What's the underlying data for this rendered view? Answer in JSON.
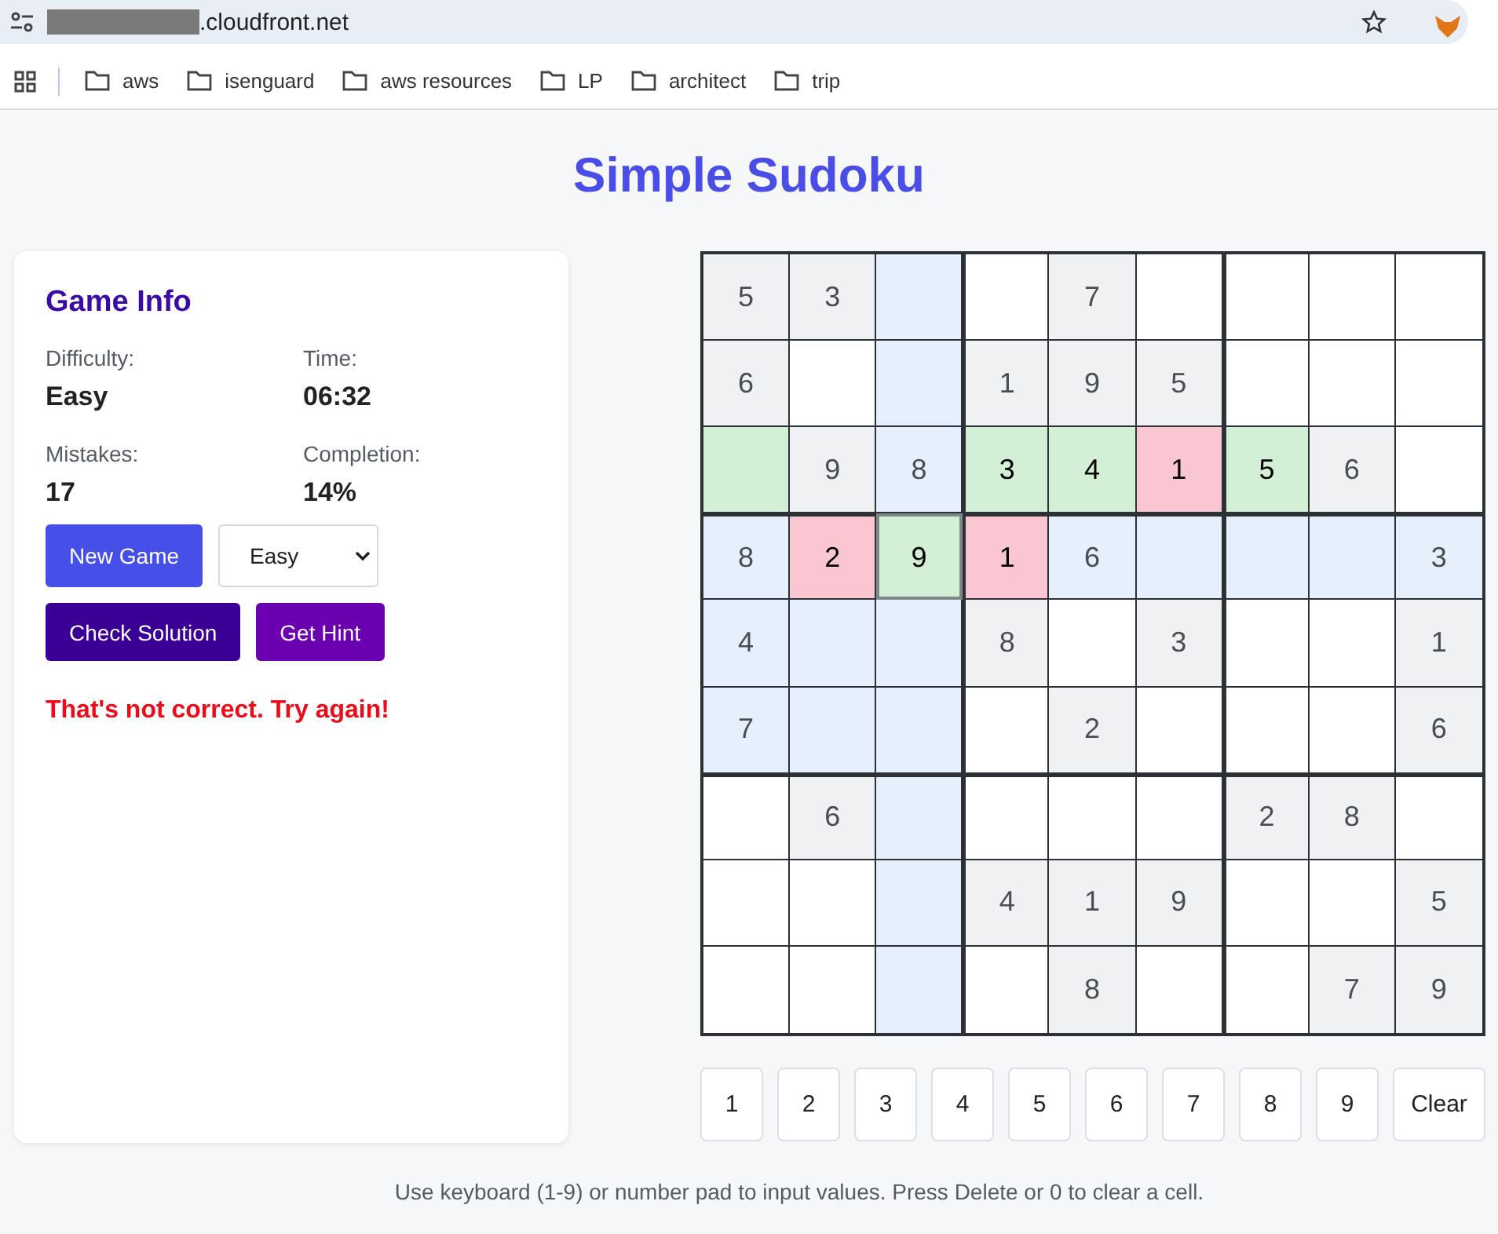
{
  "browser": {
    "url": ".cloudfront.net",
    "bookmarks": [
      "aws",
      "isenguard",
      "aws resources",
      "LP",
      "architect",
      "trip"
    ]
  },
  "title": "Simple Sudoku",
  "info": {
    "heading": "Game Info",
    "stats": [
      {
        "label": "Difficulty:",
        "value": "Easy"
      },
      {
        "label": "Time:",
        "value": "06:32"
      },
      {
        "label": "Mistakes:",
        "value": "17"
      },
      {
        "label": "Completion:",
        "value": "14%"
      }
    ],
    "new_game": "New Game",
    "difficulty_select": "Easy",
    "check": "Check Solution",
    "hint": "Get Hint",
    "message": "That's not correct. Try again!"
  },
  "grid": [
    [
      {
        "kind": "given",
        "value": "5",
        "given": true,
        "selected": false
      },
      {
        "kind": "given",
        "value": "3",
        "given": true,
        "selected": false
      },
      {
        "kind": "related",
        "selected": false
      },
      {
        "kind": "plain",
        "selected": false
      },
      {
        "kind": "given",
        "value": "7",
        "given": true,
        "selected": false
      },
      {
        "kind": "plain",
        "selected": false
      },
      {
        "kind": "plain",
        "selected": false
      },
      {
        "kind": "plain",
        "selected": false
      },
      {
        "kind": "plain",
        "selected": false
      }
    ],
    [
      {
        "kind": "given",
        "value": "6",
        "given": true,
        "selected": false
      },
      {
        "kind": "plain",
        "selected": false
      },
      {
        "kind": "related",
        "selected": false
      },
      {
        "kind": "given",
        "value": "1",
        "given": true,
        "selected": false
      },
      {
        "kind": "given",
        "value": "9",
        "given": true,
        "selected": false
      },
      {
        "kind": "given",
        "value": "5",
        "given": true,
        "selected": false
      },
      {
        "kind": "plain",
        "selected": false
      },
      {
        "kind": "plain",
        "selected": false
      },
      {
        "kind": "plain",
        "selected": false
      }
    ],
    [
      {
        "kind": "correct",
        "selected": false
      },
      {
        "kind": "given",
        "value": "9",
        "given": true,
        "selected": false
      },
      {
        "kind": "related",
        "value": "8",
        "given": true,
        "selected": false
      },
      {
        "kind": "correct",
        "value": "3",
        "given": false,
        "selected": false
      },
      {
        "kind": "correct",
        "value": "4",
        "given": false,
        "selected": false
      },
      {
        "kind": "wrong",
        "value": "1",
        "given": false,
        "selected": false
      },
      {
        "kind": "correct",
        "value": "5",
        "given": false,
        "selected": false
      },
      {
        "kind": "given",
        "value": "6",
        "given": true,
        "selected": false
      },
      {
        "kind": "plain",
        "selected": false
      }
    ],
    [
      {
        "kind": "related",
        "value": "8",
        "given": true,
        "selected": false
      },
      {
        "kind": "wrong",
        "value": "2",
        "given": false,
        "selected": false
      },
      {
        "kind": "correct",
        "value": "9",
        "given": false,
        "selected": true
      },
      {
        "kind": "wrong",
        "value": "1",
        "given": false,
        "selected": false
      },
      {
        "kind": "related",
        "value": "6",
        "given": true,
        "selected": false
      },
      {
        "kind": "related",
        "selected": false
      },
      {
        "kind": "related",
        "selected": false
      },
      {
        "kind": "related",
        "selected": false
      },
      {
        "kind": "related",
        "value": "3",
        "given": true,
        "selected": false
      }
    ],
    [
      {
        "kind": "related",
        "value": "4",
        "given": true,
        "selected": false
      },
      {
        "kind": "related",
        "selected": false
      },
      {
        "kind": "related",
        "selected": false
      },
      {
        "kind": "given",
        "value": "8",
        "given": true,
        "selected": false
      },
      {
        "kind": "plain",
        "selected": false
      },
      {
        "kind": "given",
        "value": "3",
        "given": true,
        "selected": false
      },
      {
        "kind": "plain",
        "selected": false
      },
      {
        "kind": "plain",
        "selected": false
      },
      {
        "kind": "given",
        "value": "1",
        "given": true,
        "selected": false
      }
    ],
    [
      {
        "kind": "related",
        "value": "7",
        "given": true,
        "selected": false
      },
      {
        "kind": "related",
        "selected": false
      },
      {
        "kind": "related",
        "selected": false
      },
      {
        "kind": "plain",
        "selected": false
      },
      {
        "kind": "given",
        "value": "2",
        "given": true,
        "selected": false
      },
      {
        "kind": "plain",
        "selected": false
      },
      {
        "kind": "plain",
        "selected": false
      },
      {
        "kind": "plain",
        "selected": false
      },
      {
        "kind": "given",
        "value": "6",
        "given": true,
        "selected": false
      }
    ],
    [
      {
        "kind": "plain",
        "selected": false
      },
      {
        "kind": "given",
        "value": "6",
        "given": true,
        "selected": false
      },
      {
        "kind": "related",
        "selected": false
      },
      {
        "kind": "plain",
        "selected": false
      },
      {
        "kind": "plain",
        "selected": false
      },
      {
        "kind": "plain",
        "selected": false
      },
      {
        "kind": "given",
        "value": "2",
        "given": true,
        "selected": false
      },
      {
        "kind": "given",
        "value": "8",
        "given": true,
        "selected": false
      },
      {
        "kind": "plain",
        "selected": false
      }
    ],
    [
      {
        "kind": "plain",
        "selected": false
      },
      {
        "kind": "plain",
        "selected": false
      },
      {
        "kind": "related",
        "selected": false
      },
      {
        "kind": "given",
        "value": "4",
        "given": true,
        "selected": false
      },
      {
        "kind": "given",
        "value": "1",
        "given": true,
        "selected": false
      },
      {
        "kind": "given",
        "value": "9",
        "given": true,
        "selected": false
      },
      {
        "kind": "plain",
        "selected": false
      },
      {
        "kind": "plain",
        "selected": false
      },
      {
        "kind": "given",
        "value": "5",
        "given": true,
        "selected": false
      }
    ],
    [
      {
        "kind": "plain",
        "selected": false
      },
      {
        "kind": "plain",
        "selected": false
      },
      {
        "kind": "related",
        "selected": false
      },
      {
        "kind": "plain",
        "selected": false
      },
      {
        "kind": "given",
        "value": "8",
        "given": true,
        "selected": false
      },
      {
        "kind": "plain",
        "selected": false
      },
      {
        "kind": "plain",
        "selected": false
      },
      {
        "kind": "given",
        "value": "7",
        "given": true,
        "selected": false
      },
      {
        "kind": "given",
        "value": "9",
        "given": true,
        "selected": false
      }
    ]
  ],
  "number_pad": [
    "1",
    "2",
    "3",
    "4",
    "5",
    "6",
    "7",
    "8",
    "9",
    "Clear"
  ],
  "footer": "Use keyboard (1-9) or number pad to input values. Press Delete or 0 to clear a cell."
}
